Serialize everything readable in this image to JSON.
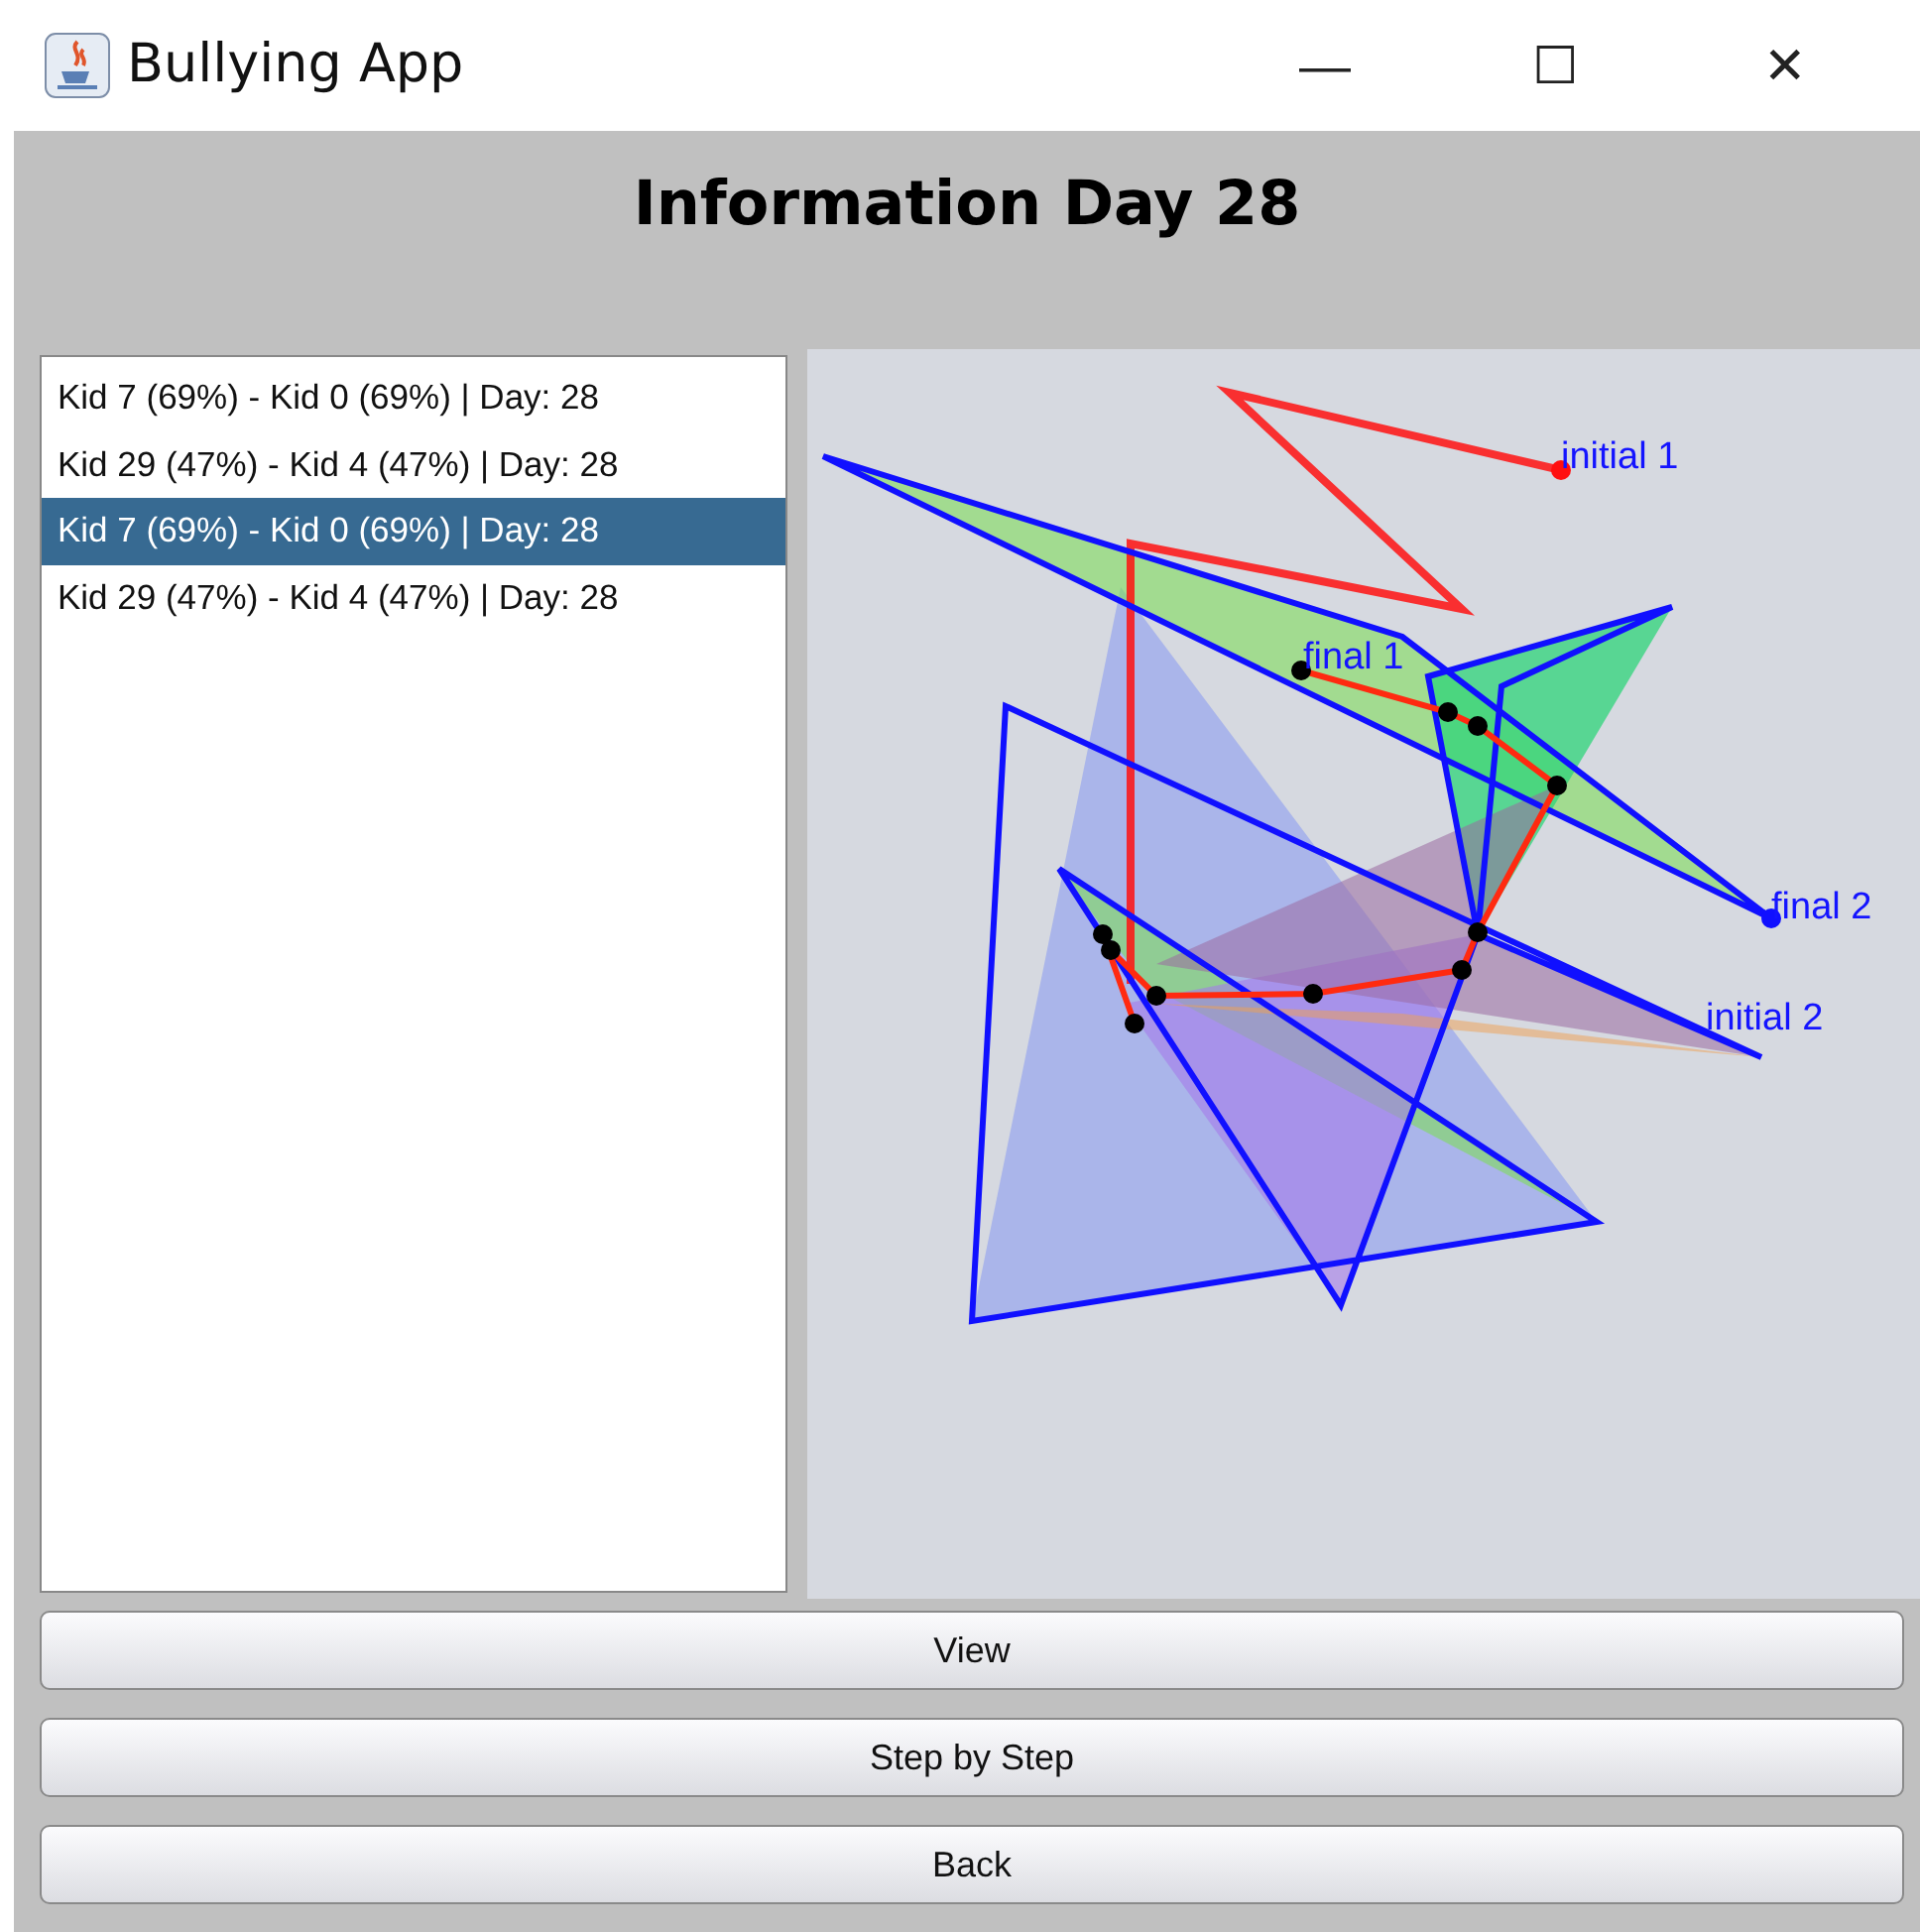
{
  "window": {
    "title": "Bullying App",
    "controls": [
      "—",
      "☐",
      "✕"
    ]
  },
  "heading": "Information Day 28",
  "list": [
    {
      "text": "Kid 7 (69%) - Kid 0 (69%) | Day: 28",
      "selected": false
    },
    {
      "text": "Kid 29 (47%) - Kid 4 (47%) | Day: 28",
      "selected": false
    },
    {
      "text": "Kid 7 (69%) - Kid 0 (69%) | Day: 28",
      "selected": true
    },
    {
      "text": "Kid 29 (47%) - Kid 4 (47%) | Day: 28",
      "selected": false
    }
  ],
  "canvas_labels": [
    {
      "text": "initial 1",
      "kind": "point"
    },
    {
      "text": "final 1",
      "kind": "point"
    },
    {
      "text": "final 2",
      "kind": "point"
    },
    {
      "text": "initial 2",
      "kind": "point"
    }
  ],
  "buttons": [
    "View",
    "Step by Step",
    "Back"
  ]
}
